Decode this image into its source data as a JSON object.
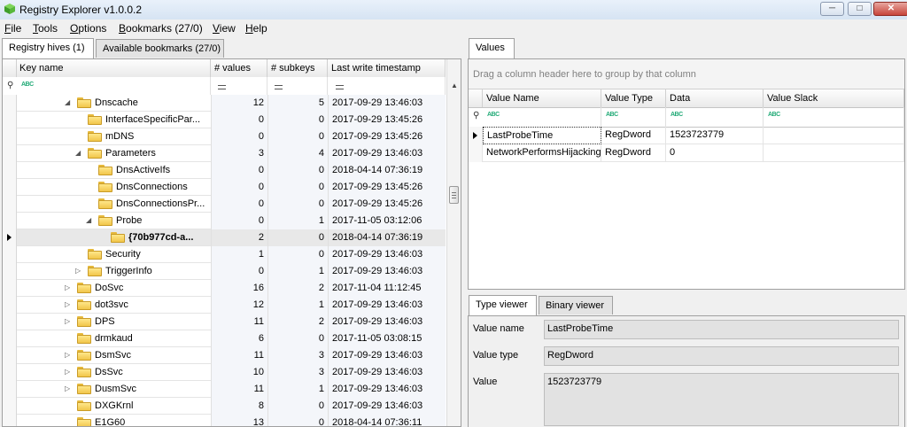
{
  "window": {
    "title": "Registry Explorer v1.0.0.2"
  },
  "menu": [
    {
      "label": "File",
      "u": "F",
      "rest": "ile"
    },
    {
      "label": "Tools",
      "u": "T",
      "rest": "ools"
    },
    {
      "label": "Options",
      "u": "O",
      "rest": "ptions"
    },
    {
      "label": "Bookmarks (27/0)",
      "u": "B",
      "rest": "ookmarks (27/0)"
    },
    {
      "label": "View",
      "u": "V",
      "rest": "iew"
    },
    {
      "label": "Help",
      "u": "H",
      "rest": "elp"
    }
  ],
  "left_tabs": [
    "Registry hives (1)",
    "Available bookmarks (27/0)"
  ],
  "key_grid": {
    "headers": [
      "Key name",
      "# values",
      "# subkeys",
      "Last write timestamp"
    ],
    "rows": [
      {
        "name": "Dnscache",
        "values": "12",
        "subkeys": "5",
        "timestamp": "2017-09-29 13:46:03",
        "expander": "open",
        "bold": false
      },
      {
        "name": "InterfaceSpecificPar...",
        "values": "0",
        "subkeys": "0",
        "timestamp": "2017-09-29 13:45:26",
        "expander": "",
        "bold": false
      },
      {
        "name": "mDNS",
        "values": "0",
        "subkeys": "0",
        "timestamp": "2017-09-29 13:45:26",
        "expander": "",
        "bold": false
      },
      {
        "name": "Parameters",
        "values": "3",
        "subkeys": "4",
        "timestamp": "2017-09-29 13:46:03",
        "expander": "open",
        "bold": false
      },
      {
        "name": "DnsActiveIfs",
        "values": "0",
        "subkeys": "0",
        "timestamp": "2018-04-14 07:36:19",
        "expander": "",
        "bold": false
      },
      {
        "name": "DnsConnections",
        "values": "0",
        "subkeys": "0",
        "timestamp": "2017-09-29 13:45:26",
        "expander": "",
        "bold": false
      },
      {
        "name": "DnsConnectionsPr...",
        "values": "0",
        "subkeys": "0",
        "timestamp": "2017-09-29 13:45:26",
        "expander": "",
        "bold": false
      },
      {
        "name": "Probe",
        "values": "0",
        "subkeys": "1",
        "timestamp": "2017-11-05 03:12:06",
        "expander": "open",
        "bold": false
      },
      {
        "name": "{70b977cd-a...",
        "values": "2",
        "subkeys": "0",
        "timestamp": "2018-04-14 07:36:19",
        "expander": "",
        "bold": true
      },
      {
        "name": "Security",
        "values": "1",
        "subkeys": "0",
        "timestamp": "2017-09-29 13:46:03",
        "expander": "",
        "bold": false
      },
      {
        "name": "TriggerInfo",
        "values": "0",
        "subkeys": "1",
        "timestamp": "2017-09-29 13:46:03",
        "expander": "closed",
        "bold": false
      },
      {
        "name": "DoSvc",
        "values": "16",
        "subkeys": "2",
        "timestamp": "2017-11-04 11:12:45",
        "expander": "closed",
        "bold": false
      },
      {
        "name": "dot3svc",
        "values": "12",
        "subkeys": "1",
        "timestamp": "2017-09-29 13:46:03",
        "expander": "closed",
        "bold": false
      },
      {
        "name": "DPS",
        "values": "11",
        "subkeys": "2",
        "timestamp": "2017-09-29 13:46:03",
        "expander": "closed",
        "bold": false
      },
      {
        "name": "drmkaud",
        "values": "6",
        "subkeys": "0",
        "timestamp": "2017-11-05 03:08:15",
        "expander": "",
        "bold": false
      },
      {
        "name": "DsmSvc",
        "values": "11",
        "subkeys": "3",
        "timestamp": "2017-09-29 13:46:03",
        "expander": "closed",
        "bold": false
      },
      {
        "name": "DsSvc",
        "values": "10",
        "subkeys": "3",
        "timestamp": "2017-09-29 13:46:03",
        "expander": "closed",
        "bold": false
      },
      {
        "name": "DusmSvc",
        "values": "11",
        "subkeys": "1",
        "timestamp": "2017-09-29 13:46:03",
        "expander": "closed",
        "bold": false
      },
      {
        "name": "DXGKrnl",
        "values": "8",
        "subkeys": "0",
        "timestamp": "2017-09-29 13:46:03",
        "expander": "",
        "bold": false
      },
      {
        "name": "E1G60",
        "values": "13",
        "subkeys": "0",
        "timestamp": "2018-04-14 07:36:11",
        "expander": "",
        "bold": false
      }
    ]
  },
  "values_tab": "Values",
  "values_grid": {
    "group_hint": "Drag a column header here to group by that column",
    "headers": [
      "Value Name",
      "Value Type",
      "Data",
      "Value Slack"
    ],
    "rows": [
      {
        "name": "LastProbeTime",
        "type": "RegDword",
        "data": "1523723779",
        "slack": ""
      },
      {
        "name": "NetworkPerformsHijacking",
        "type": "RegDword",
        "data": "0",
        "slack": ""
      }
    ]
  },
  "viewer_tabs": [
    "Type viewer",
    "Binary viewer"
  ],
  "type_viewer": {
    "value_name_label": "Value name",
    "value_name": "LastProbeTime",
    "value_type_label": "Value type",
    "value_type": "RegDword",
    "value_label": "Value",
    "value": "1523723779"
  },
  "colors": {
    "folder": "#f1c64a",
    "selected_row": "#e8e8e8",
    "title_bar": "#dbe6f4"
  }
}
